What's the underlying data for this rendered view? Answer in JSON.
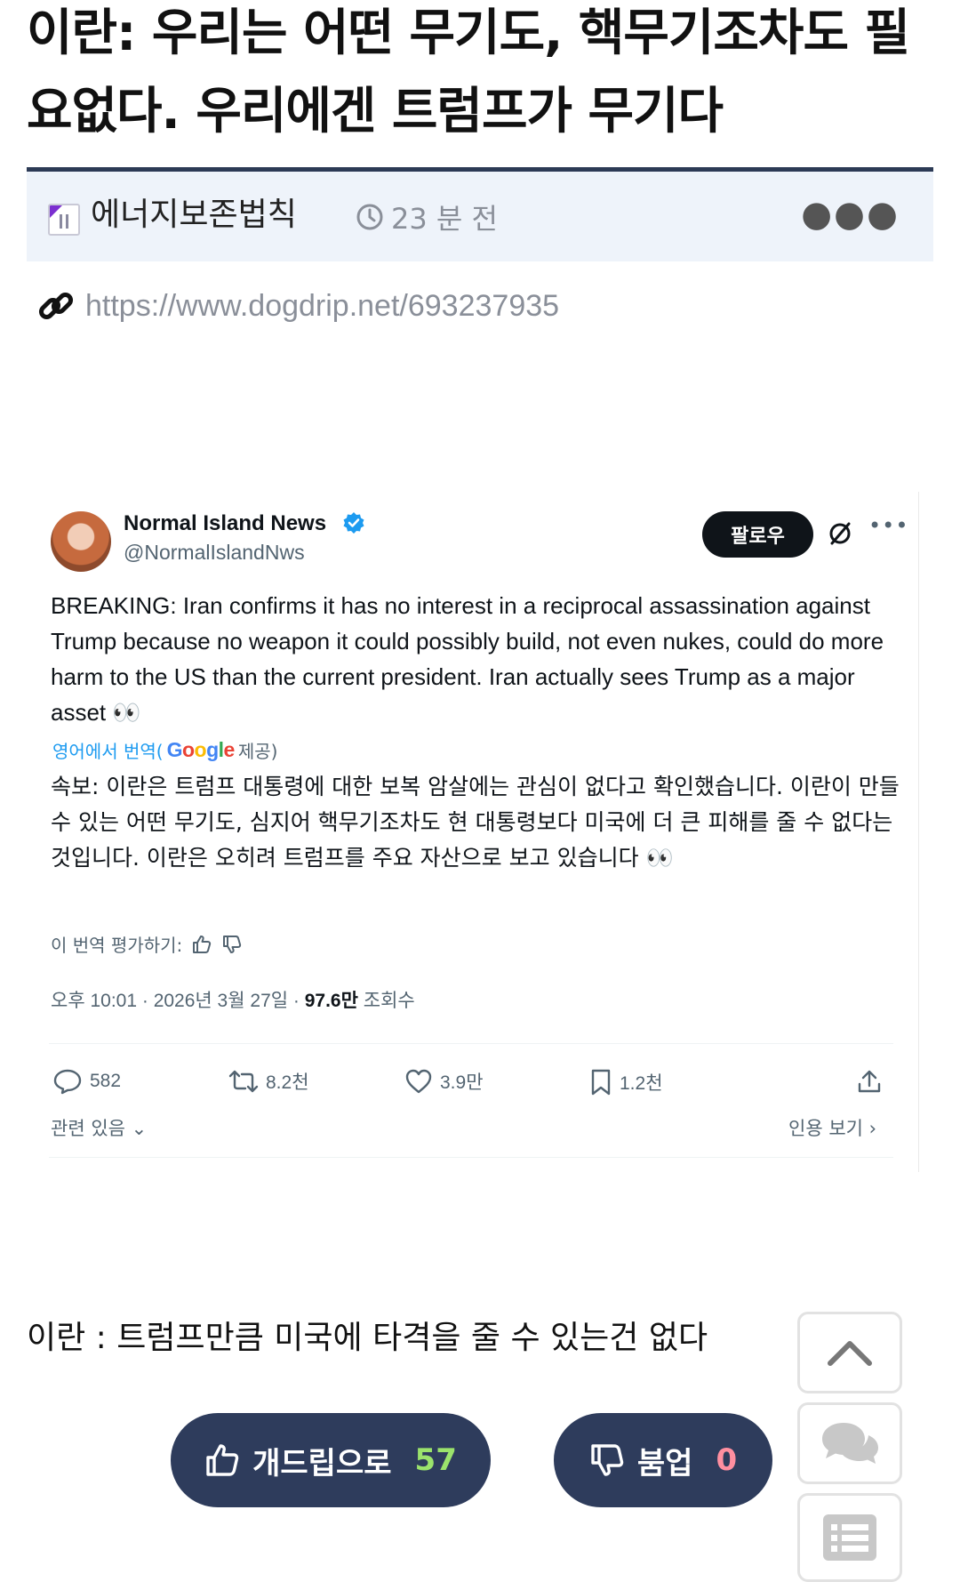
{
  "post": {
    "title": "이란: 우리는 어떤 무기도, 핵무기조차도 필요없다. 우리에겐 트럼프가 무기다",
    "author": "에너지보존법칙",
    "time_ago": "23 분 전",
    "url": "https://www.dogdrip.net/693237935",
    "caption": "이란 : 트럼프만큼 미국에 타격을 줄 수 있는건 없다"
  },
  "tweet": {
    "name": "Normal Island News",
    "handle": "@NormalIslandNws",
    "follow_label": "팔로우",
    "body_en": "BREAKING: Iran confirms it has no interest in a reciprocal assassination against Trump because no weapon it could possibly build, not even nukes, could do more harm to the US than the current president. Iran actually sees Trump as a major asset 👀",
    "translate_prefix": "영어에서 번역(",
    "translate_suffix": "제공)",
    "google_label": "Google",
    "body_ko": "속보: 이란은 트럼프 대통령에 대한 보복 암살에는 관심이 없다고 확인했습니다. 이란이 만들 수 있는 어떤 무기도, 심지어 핵무기조차도 현 대통령보다 미국에 더 큰 피해를 줄 수 없다는 것입니다. 이란은 오히려 트럼프를 주요 자산으로 보고 있습니다 👀",
    "rate_label": "이 번역 평가하기:",
    "date_text": "오후 10:01 · 2026년 3월 27일 · ",
    "views_count": "97.6만",
    "views_label": " 조회수",
    "replies": "582",
    "retweets": "8.2천",
    "likes": "3.9만",
    "bookmarks": "1.2천",
    "related_label": "관련 있음",
    "quotes_label": "인용 보기"
  },
  "votes": {
    "up_label": "개드립으로",
    "up_count": "57",
    "down_label": "붐업",
    "down_count": "0"
  },
  "colors": {
    "meta_bg": "#eef3fa",
    "meta_border": "#2c3a55",
    "vote_bg": "#2e3c5c",
    "up_count": "#9be36c",
    "down_count": "#ff8fa0",
    "verified": "#1d9bf0"
  },
  "icons": [
    "clock-icon",
    "link-icon",
    "verified-icon",
    "grok-icon",
    "reply-icon",
    "retweet-icon",
    "like-icon",
    "bookmark-icon",
    "share-icon",
    "thumbs-up-icon",
    "thumbs-down-icon",
    "arrow-up-icon",
    "comments-icon",
    "list-icon"
  ]
}
